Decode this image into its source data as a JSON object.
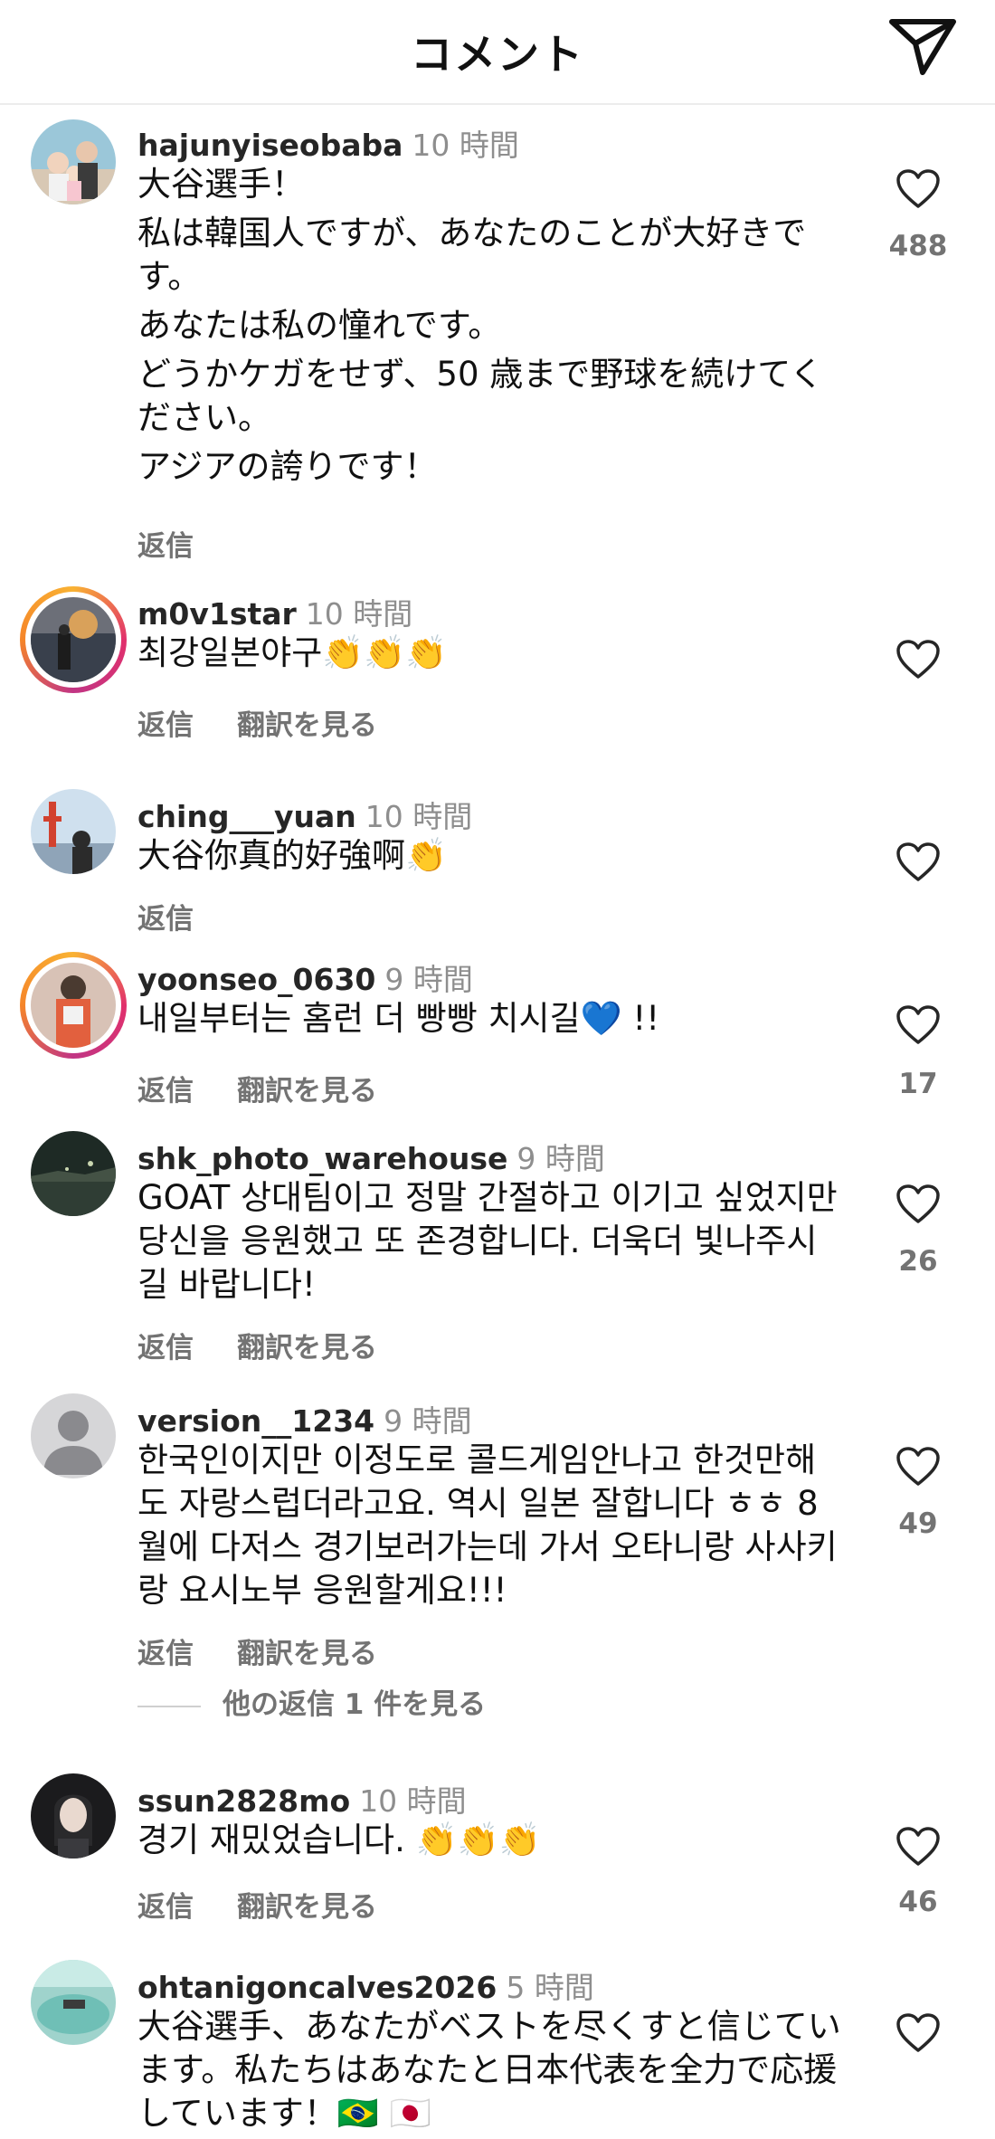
{
  "header": {
    "title": "コメント"
  },
  "actions": {
    "reply": "返信",
    "translate": "翻訳を見る"
  },
  "comments": [
    {
      "user": "hajunyiseobaba",
      "time": "10 時間",
      "lines": [
        "大谷選手！",
        "私は韓国人ですが、あなたのことが大好きです。",
        "あなたは私の憧れです。",
        "どうかケガをせず、50 歳まで野球を続けてください。",
        "アジアの誇りです！"
      ],
      "likes": "488"
    },
    {
      "user": "m0v1star",
      "time": "10 時間",
      "text": "최강일본야구👏👏👏"
    },
    {
      "user": "ching___yuan",
      "time": "10 時間",
      "text": "大谷你真的好強啊👏"
    },
    {
      "user": "yoonseo_0630",
      "time": "9 時間",
      "text": "내일부터는 홈런 더 빵빵 치시길💙 !!",
      "likes": "17"
    },
    {
      "user": "shk_photo_warehouse",
      "time": "9 時間",
      "text": "GOAT 상대팀이고 정말 간절하고 이기고 싶었지만 당신을 응원했고 또 존경합니다. 더욱더 빛나주시길 바랍니다!",
      "likes": "26"
    },
    {
      "user": "version__1234",
      "time": "9 時間",
      "text": "한국인이지만 이정도로 콜드게임안나고 한것만해도 자랑스럽더라고요. 역시 일본 잘합니다 ㅎㅎ 8월에 다저스 경기보러가는데 가서 오타니랑 사사키랑 요시노부 응원할게요!!!",
      "likes": "49",
      "more_replies": "他の返信 1 件を見る"
    },
    {
      "user": "ssun2828mo",
      "time": "10 時間",
      "text": "경기 재밌었습니다. 👏👏👏",
      "likes": "46"
    },
    {
      "user": "ohtanigoncalves2026",
      "time": "5 時間",
      "text": "大谷選手、あなたがベストを尽くすと信じています。私たちはあなたと日本代表を全力で応援しています！🇧🇷 🇯🇵"
    }
  ]
}
